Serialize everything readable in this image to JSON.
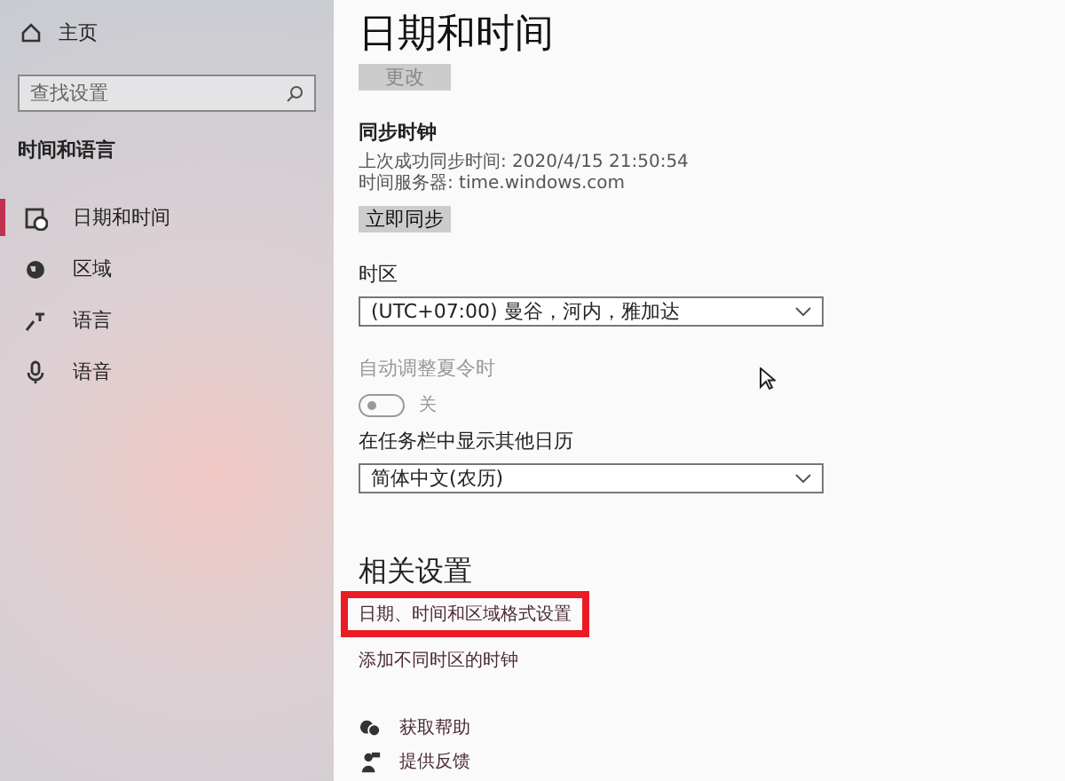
{
  "sidebar": {
    "home": "主页",
    "search": {
      "placeholder": "查找设置"
    },
    "section": "时间和语言",
    "items": [
      {
        "label": "日期和时间",
        "selected": true
      },
      {
        "label": "区域",
        "selected": false
      },
      {
        "label": "语言",
        "selected": false
      },
      {
        "label": "语音",
        "selected": false
      }
    ]
  },
  "main": {
    "title": "日期和时间",
    "change_button": {
      "label": "更改",
      "disabled": true
    },
    "sync": {
      "heading": "同步时钟",
      "last_sync": "上次成功同步时间: 2020/4/15 21:50:54",
      "server": "时间服务器: time.windows.com",
      "button": "立即同步"
    },
    "timezone": {
      "label": "时区",
      "value": "(UTC+07:00) 曼谷，河内，雅加达"
    },
    "dst": {
      "label": "自动调整夏令时",
      "on": false,
      "disabled": true,
      "state_text": "关"
    },
    "calendar": {
      "label": "在任务栏中显示其他日历",
      "value": "简体中文(农历)"
    },
    "related": {
      "heading": "相关设置",
      "links": [
        {
          "label": "日期、时间和区域格式设置",
          "highlighted": true
        },
        {
          "label": "添加不同时区的时钟",
          "highlighted": false
        }
      ]
    },
    "help": [
      {
        "label": "获取帮助"
      },
      {
        "label": "提供反馈"
      }
    ]
  }
}
